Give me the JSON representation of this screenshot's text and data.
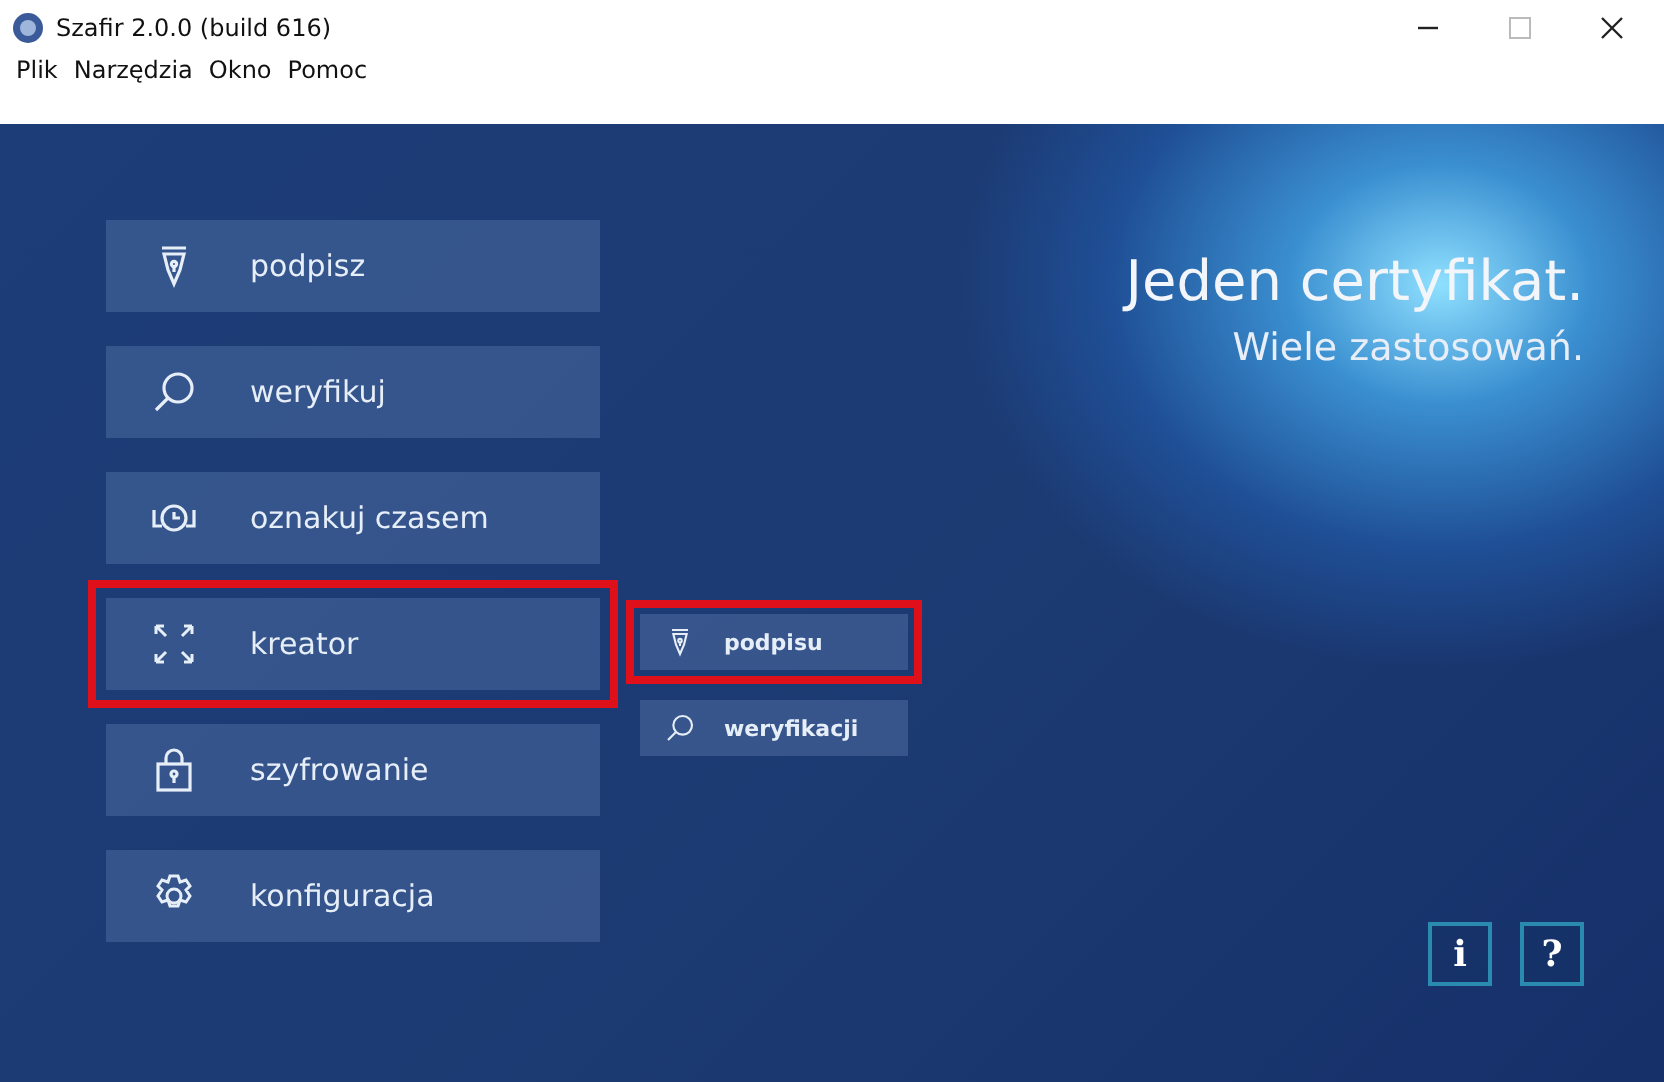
{
  "window": {
    "title": "Szafir 2.0.0 (build 616)"
  },
  "menu_bar": [
    "Plik",
    "Narzędzia",
    "Okno",
    "Pomoc"
  ],
  "main_menu": [
    {
      "kind": "sign",
      "label": "podpisz",
      "highlighted": false
    },
    {
      "kind": "verify",
      "label": "weryfikuj",
      "highlighted": false
    },
    {
      "kind": "timestamp",
      "label": "oznakuj czasem",
      "highlighted": false
    },
    {
      "kind": "wizard",
      "label": "kreator",
      "highlighted": true
    },
    {
      "kind": "encrypt",
      "label": "szyfrowanie",
      "highlighted": false
    },
    {
      "kind": "settings",
      "label": "konfiguracja",
      "highlighted": false
    }
  ],
  "wizard_submenu": [
    {
      "kind": "sign",
      "label": "podpisu",
      "highlighted": true
    },
    {
      "kind": "verify",
      "label": "weryfikacji",
      "highlighted": false
    }
  ],
  "headline": "Jeden certyfikat.",
  "subheadline": "Wiele zastosowań.",
  "corner_buttons": [
    "i",
    "?"
  ]
}
